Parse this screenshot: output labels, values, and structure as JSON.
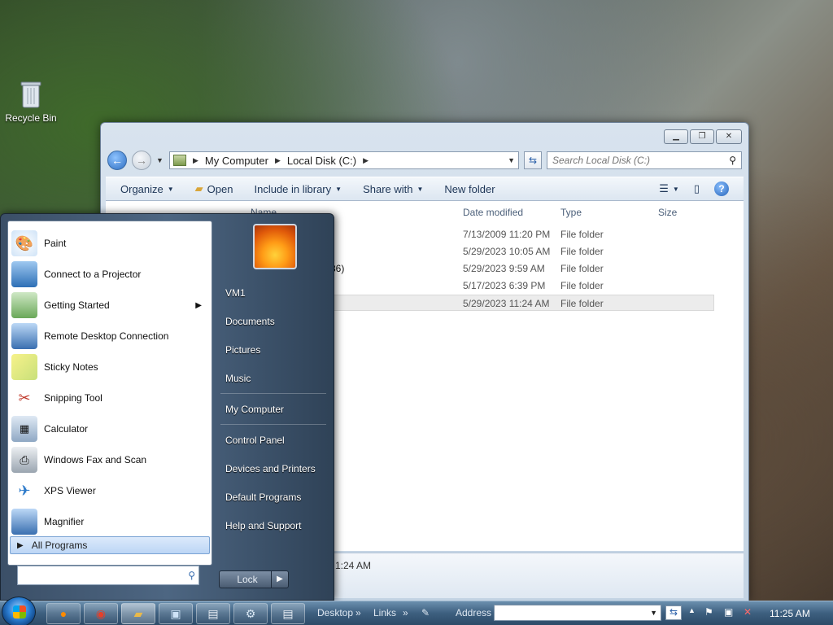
{
  "desktop": {
    "recycle_bin": "Recycle Bin"
  },
  "explorer": {
    "breadcrumb": [
      "My Computer",
      "Local Disk (C:)"
    ],
    "search_placeholder": "Search Local Disk (C:)",
    "toolbar": {
      "organize": "Organize",
      "open": "Open",
      "include": "Include in library",
      "share": "Share with",
      "new_folder": "New folder"
    },
    "columns": {
      "name": "Name",
      "date": "Date modified",
      "type": "Type",
      "size": "Size"
    },
    "rows": [
      {
        "name": "",
        "date": "7/13/2009 11:20 PM",
        "type": "File folder"
      },
      {
        "name": "",
        "date": "5/29/2023 10:05 AM",
        "type": "File folder"
      },
      {
        "name": "86)",
        "date": "5/29/2023 9:59 AM",
        "type": "File folder"
      },
      {
        "name": "",
        "date": "5/17/2023 6:39 PM",
        "type": "File folder"
      },
      {
        "name": "",
        "date": "5/29/2023 11:24 AM",
        "type": "File folder"
      }
    ],
    "status_date": "1:24 AM"
  },
  "start_menu": {
    "programs": [
      {
        "label": "Paint",
        "icon": "paint-icon"
      },
      {
        "label": "Connect to a Projector",
        "icon": "projector-icon"
      },
      {
        "label": "Getting Started",
        "icon": "getting-started-icon"
      },
      {
        "label": "Remote Desktop Connection",
        "icon": "remote-desktop-icon"
      },
      {
        "label": "Sticky Notes",
        "icon": "sticky-notes-icon"
      },
      {
        "label": "Snipping Tool",
        "icon": "snipping-tool-icon"
      },
      {
        "label": "Calculator",
        "icon": "calculator-icon"
      },
      {
        "label": "Windows Fax and Scan",
        "icon": "fax-icon"
      },
      {
        "label": "XPS Viewer",
        "icon": "xps-viewer-icon"
      },
      {
        "label": "Magnifier",
        "icon": "magnifier-icon"
      }
    ],
    "all_programs": "All Programs",
    "right_links": {
      "user": "VM1",
      "documents": "Documents",
      "pictures": "Pictures",
      "music": "Music",
      "computer": "My Computer",
      "control_panel": "Control Panel",
      "devices": "Devices and Printers",
      "default_programs": "Default Programs",
      "help": "Help and Support"
    },
    "lock": "Lock"
  },
  "taskbar": {
    "desktop": "Desktop",
    "links": "Links",
    "address": "Address",
    "clock": "11:25 AM"
  }
}
